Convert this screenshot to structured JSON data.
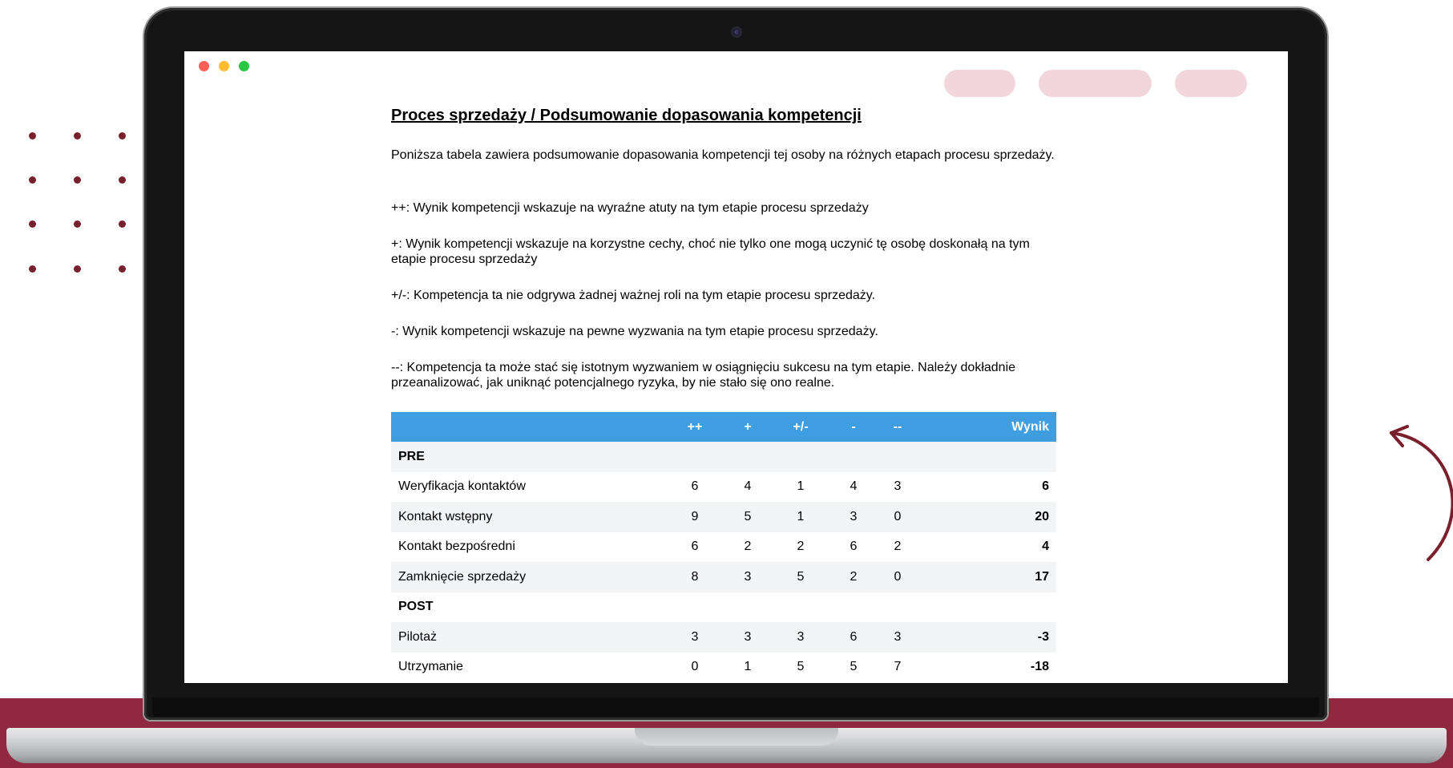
{
  "doc": {
    "title": "Proces sprzedaży / Podsumowanie dopasowania kompetencji",
    "intro": "Poniższa tabela zawiera podsumowanie dopasowania kompetencji tej osoby na różnych etapach procesu sprzedaży.",
    "legend": [
      "++: Wynik kompetencji wskazuje na wyraźne atuty na tym etapie procesu sprzedaży",
      "+: Wynik kompetencji wskazuje na korzystne cechy, choć nie tylko one mogą uczynić tę osobę doskonałą na tym etapie procesu sprzedaży",
      "+/-: Kompetencja ta nie odgrywa żadnej ważnej roli na tym etapie procesu sprzedaży.",
      "-: Wynik kompetencji wskazuje na pewne wyzwania na tym etapie procesu sprzedaży.",
      "--: Kompetencja ta może stać się istotnym wyzwaniem w osiągnięciu sukcesu na tym etapie. Należy dokładnie przeanalizować, jak uniknąć potencjalnego ryzyka, by nie stało się ono realne."
    ]
  },
  "table": {
    "headers": [
      "",
      "++",
      "+",
      "+/-",
      "-",
      "--",
      "Wynik"
    ],
    "sections": [
      {
        "name": "PRE",
        "rows": [
          {
            "label": "Weryfikacja kontaktów",
            "values": [
              "6",
              "4",
              "1",
              "4",
              "3"
            ],
            "score": "6"
          },
          {
            "label": "Kontakt wstępny",
            "values": [
              "9",
              "5",
              "1",
              "3",
              "0"
            ],
            "score": "20"
          },
          {
            "label": "Kontakt bezpośredni",
            "values": [
              "6",
              "2",
              "2",
              "6",
              "2"
            ],
            "score": "4"
          },
          {
            "label": "Zamknięcie sprzedaży",
            "values": [
              "8",
              "3",
              "5",
              "2",
              "0"
            ],
            "score": "17"
          }
        ]
      },
      {
        "name": "POST",
        "rows": [
          {
            "label": "Pilotaż",
            "values": [
              "3",
              "3",
              "3",
              "6",
              "3"
            ],
            "score": "-3"
          },
          {
            "label": "Utrzymanie",
            "values": [
              "0",
              "1",
              "5",
              "5",
              "7"
            ],
            "score": "-18"
          }
        ]
      }
    ]
  },
  "colors": {
    "header_blue": "#3f9ee0",
    "accent_maroon": "#8e2940",
    "nav_pill_pink": "#f3d6dd"
  }
}
